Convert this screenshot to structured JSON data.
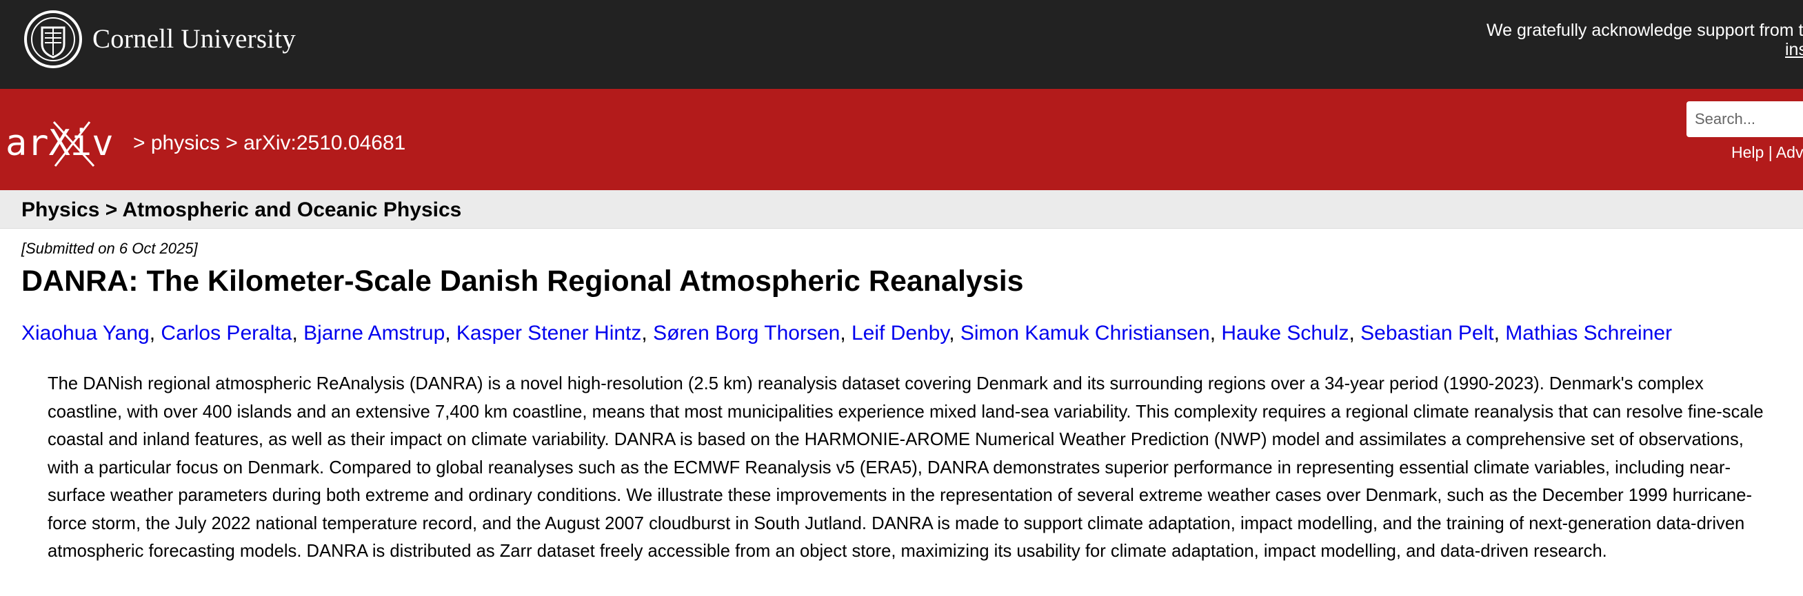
{
  "header": {
    "institution": "Cornell University",
    "support_text": "We gratefully acknowledge support from the",
    "support_link": "ins",
    "seal_icon": "cornell-seal-icon"
  },
  "arxiv_bar": {
    "logo_text": "arXiv",
    "logo_icon": "arxiv-logo-icon",
    "breadcrumb": {
      "sep1": ">",
      "section": "physics",
      "sep2": ">",
      "paper_id": "arXiv:2510.04681"
    },
    "search": {
      "placeholder": "Search..."
    },
    "links": {
      "help": "Help",
      "sep": "|",
      "advanced": "Adv"
    }
  },
  "category": {
    "label": "Physics > Atmospheric and Oceanic Physics"
  },
  "paper": {
    "submitted": "[Submitted on 6 Oct 2025]",
    "title": "DANRA: The Kilometer-Scale Danish Regional Atmospheric Reanalysis",
    "authors": [
      "Xiaohua Yang",
      "Carlos Peralta",
      "Bjarne Amstrup",
      "Kasper Stener Hintz",
      "Søren Borg Thorsen",
      "Leif Denby",
      "Simon Kamuk Christiansen",
      "Hauke Schulz",
      "Sebastian Pelt",
      "Mathias Schreiner"
    ],
    "author_separator": ", ",
    "abstract": "The DANish regional atmospheric ReAnalysis (DANRA) is a novel high-resolution (2.5 km) reanalysis dataset covering Denmark and its surrounding regions over a 34-year period (1990-2023). Denmark's complex coastline, with over 400 islands and an extensive 7,400 km coastline, means that most municipalities experience mixed land-sea variability. This complexity requires a regional climate reanalysis that can resolve fine-scale coastal and inland features, as well as their impact on climate variability. DANRA is based on the HARMONIE-AROME Numerical Weather Prediction (NWP) model and assimilates a comprehensive set of observations, with a particular focus on Denmark. Compared to global reanalyses such as the ECMWF Reanalysis v5 (ERA5), DANRA demonstrates superior performance in representing essential climate variables, including near-surface weather parameters during both extreme and ordinary conditions. We illustrate these improvements in the representation of several extreme weather cases over Denmark, such as the December 1999 hurricane-force storm, the July 2022 national temperature record, and the August 2007 cloudburst in South Jutland. DANRA is made to support climate adaptation, impact modelling, and the training of next-generation data-driven atmospheric forecasting models. DANRA is distributed as Zarr dataset freely accessible from an object store, maximizing its usability for climate adaptation, impact modelling, and data-driven research."
  },
  "colors": {
    "header_bg": "#222222",
    "arxiv_red": "#b31b1b",
    "category_bg": "#ebebeb",
    "link_blue": "#0000ee"
  }
}
